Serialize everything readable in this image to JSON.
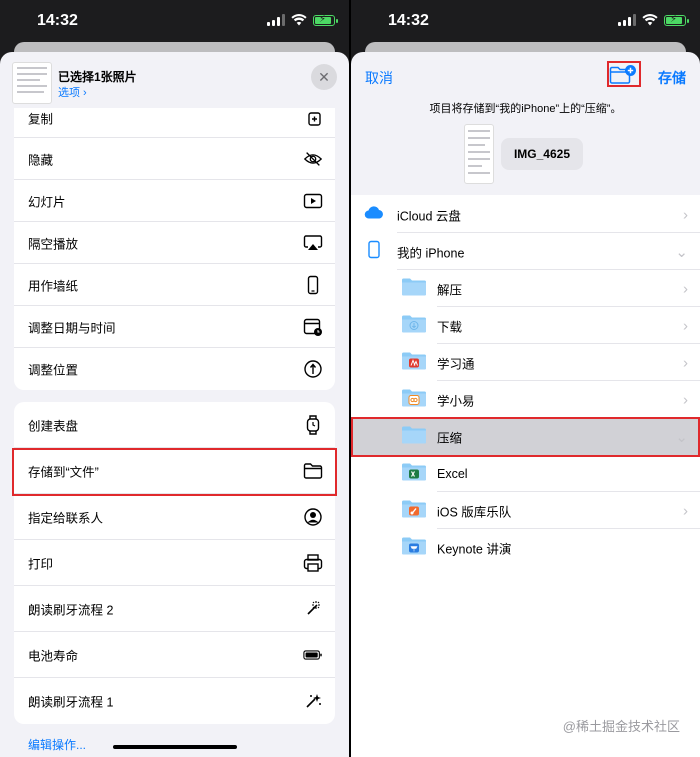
{
  "status_bar": {
    "time": "14:32"
  },
  "left": {
    "header": {
      "title": "已选择1张照片",
      "options": "选项 ›"
    },
    "group1": [
      "复制",
      "隐藏",
      "幻灯片",
      "隔空播放",
      "用作墙纸",
      "调整日期与时间",
      "调整位置"
    ],
    "group2": [
      "创建表盘",
      "存储到“文件”",
      "指定给联系人",
      "打印",
      "朗读刷牙流程 2",
      "电池寿命",
      "朗读刷牙流程 1"
    ],
    "edit_actions": "编辑操作..."
  },
  "right": {
    "cancel": "取消",
    "save": "存储",
    "destination_note": "项目将存储到“我的iPhone”上的“压缩”。",
    "file_name": "IMG_4625",
    "locations": [
      {
        "name": "iCloud 云盘",
        "icon": "icloud-icon",
        "chevron": "›"
      },
      {
        "name": "我的 iPhone",
        "icon": "iphone-icon",
        "chevron": "⌄"
      }
    ],
    "folders": [
      {
        "name": "解压",
        "icon": "folder-icon",
        "chevron": "›"
      },
      {
        "name": "下载",
        "icon": "download-folder-icon",
        "chevron": "›"
      },
      {
        "name": "学习通",
        "icon": "xuexitong-folder-icon",
        "chevron": "›"
      },
      {
        "name": "学小易",
        "icon": "xuexiaoyi-folder-icon",
        "chevron": "›"
      },
      {
        "name": "压缩",
        "icon": "folder-icon",
        "chevron": "⌄"
      },
      {
        "name": "Excel",
        "icon": "excel-folder-icon",
        "chevron": ""
      },
      {
        "name": "iOS 版库乐队",
        "icon": "garageband-folder-icon",
        "chevron": "›"
      },
      {
        "name": "Keynote 讲演",
        "icon": "keynote-folder-icon",
        "chevron": ""
      }
    ]
  },
  "watermark": "@稀土掘金技术社区",
  "colors": {
    "accent": "#0a7aff",
    "highlight_box": "#e0292c",
    "sheet_bg": "#f2f2f7",
    "selected_row": "#d1d1d6"
  }
}
